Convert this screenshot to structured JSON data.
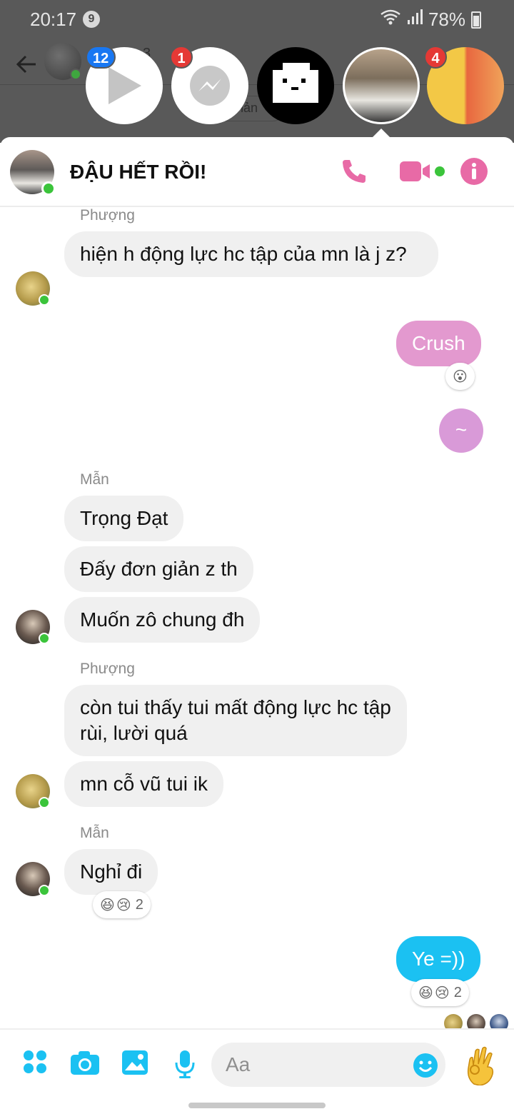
{
  "status_bar": {
    "time": "20:17",
    "notification_count": "9",
    "battery": "78%"
  },
  "background_app": {
    "name_fragment": "3",
    "pill_fragment": "nản"
  },
  "chat_heads": {
    "video_badge": "12",
    "messenger_badge": "1",
    "pikachu_badge": "4"
  },
  "conversation": {
    "title": "ĐẬU HẾT RỒI!",
    "accent_color": "#e86aa6"
  },
  "messages": [
    {
      "sender": "Phượng",
      "text": "hiện h động lực hc tập của mn là j z?"
    },
    {
      "outgoing": true,
      "text": "Crush",
      "reaction": "😮"
    },
    {
      "outgoing": true,
      "text": "~"
    },
    {
      "sender": "Mẫn",
      "text": "Trọng Đạt"
    },
    {
      "text": "Đấy đơn giản z th"
    },
    {
      "text": "Muốn zô chung đh"
    },
    {
      "sender": "Phượng",
      "text": "còn tui thấy tui mất động lực hc tập rùi, lười quá"
    },
    {
      "text": "mn cỗ vũ tui ik"
    },
    {
      "sender": "Mẫn",
      "text": "Nghỉ đi",
      "reactions": [
        "😆",
        "😢"
      ],
      "reaction_count": "2"
    },
    {
      "outgoing": true,
      "text": "Ye =))",
      "reactions": [
        "😆",
        "😢"
      ],
      "reaction_count": "2"
    }
  ],
  "composer": {
    "placeholder": "Aa"
  }
}
